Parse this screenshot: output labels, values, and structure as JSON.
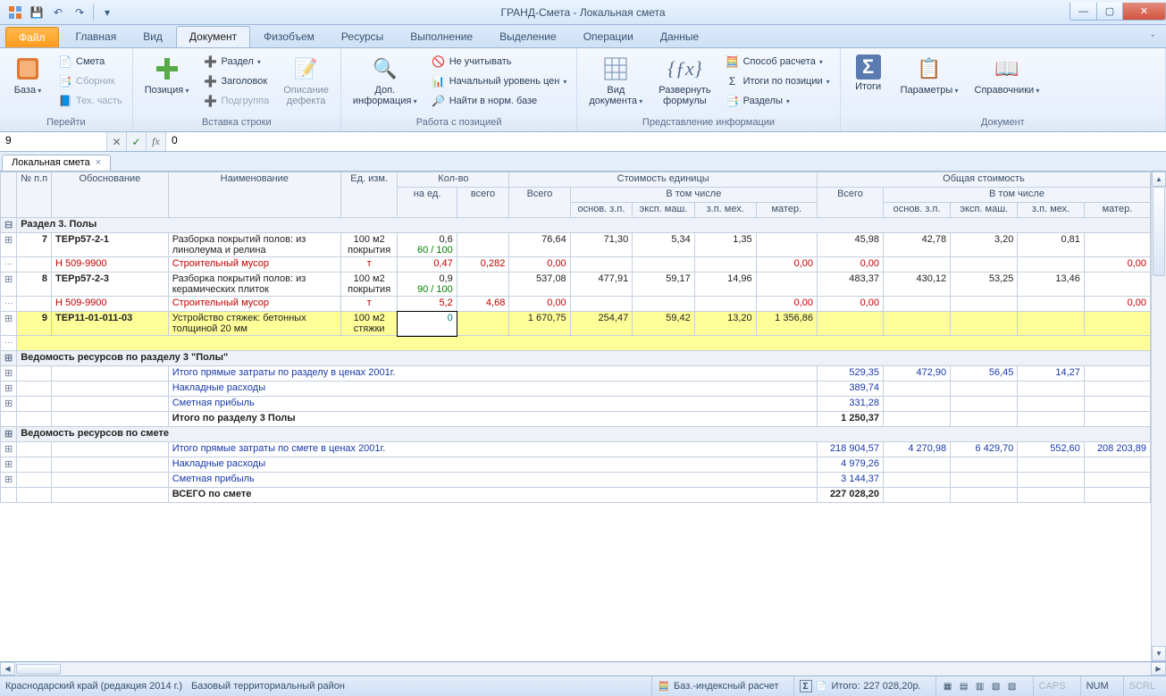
{
  "title": "ГРАНД-Смета - Локальная смета",
  "tabs": {
    "file": "Файл",
    "items": [
      "Главная",
      "Вид",
      "Документ",
      "Физобъем",
      "Ресурсы",
      "Выполнение",
      "Выделение",
      "Операции",
      "Данные"
    ],
    "active": 2
  },
  "ribbon": {
    "g1": {
      "label": "Перейти",
      "base": "База",
      "smeta": "Смета",
      "sbornik": "Сборник",
      "tech": "Тех. часть"
    },
    "g2": {
      "label": "Вставка строки",
      "pos": "Позиция",
      "razdel": "Раздел",
      "zagolovok": "Заголовок",
      "podgroup": "Подгруппа",
      "defect": "Описание\nдефекта"
    },
    "g3": {
      "label": "Работа с позицией",
      "dopinfo": "Доп.\nинформация",
      "neuchit": "Не учитывать",
      "nachur": "Начальный уровень цен",
      "najti": "Найти в норм. базе"
    },
    "g4": {
      "label": "Представление информации",
      "viddok": "Вид\nдокумента",
      "razvform": "Развернуть\nформулы",
      "sposob": "Способ расчета",
      "itogipos": "Итоги по позиции",
      "razdely": "Разделы"
    },
    "g5": {
      "label": "Документ",
      "itogi": "Итоги",
      "param": "Параметры",
      "sprav": "Справочники"
    }
  },
  "formula": {
    "cell": "9",
    "value": "0"
  },
  "doctab": "Локальная смета",
  "headers": {
    "num": "№\nп.п",
    "obj": "Обоснование",
    "name": "Наименование",
    "unit": "Ед. изм.",
    "qty": "Кол-во",
    "qty_ed": "на ед.",
    "qty_tot": "всего",
    "unitcost": "Стоимость единицы",
    "total": "Общая стоимость",
    "vsego": "Всего",
    "vtom": "В том числе",
    "oz": "основ. з.п.",
    "em": "эксп. маш.",
    "zm": "з.п. мех.",
    "mat": "матер."
  },
  "rows": {
    "section": "Раздел 3. Полы",
    "r7": {
      "n": "7",
      "obj": "ТЕРр57-2-1",
      "name": "Разборка покрытий полов: из линолеума и релина",
      "unit": "100 м2 покрытия",
      "qe": "0,6",
      "qf": "60 / 100",
      "uv": "76,64",
      "uo": "71,30",
      "ue": "5,34",
      "uz": "1,35",
      "tv": "45,98",
      "to": "42,78",
      "te": "3,20",
      "tz": "0,81"
    },
    "r7m": {
      "obj": "Н             509-9900",
      "name": "Строительный мусор",
      "unit": "т",
      "qe": "0,47",
      "qt": "0,282",
      "uv": "0,00",
      "um": "0,00",
      "tv": "0,00",
      "tm": "0,00"
    },
    "r8": {
      "n": "8",
      "obj": "ТЕРр57-2-3",
      "name": "Разборка покрытий полов: из керамических плиток",
      "unit": "100 м2 покрытия",
      "qe": "0,9",
      "qf": "90 / 100",
      "uv": "537,08",
      "uo": "477,91",
      "ue": "59,17",
      "uz": "14,96",
      "tv": "483,37",
      "to": "430,12",
      "te": "53,25",
      "tz": "13,46"
    },
    "r8m": {
      "obj": "Н             509-9900",
      "name": "Строительный мусор",
      "unit": "т",
      "qe": "5,2",
      "qt": "4,68",
      "uv": "0,00",
      "um": "0,00",
      "tv": "0,00",
      "tm": "0,00"
    },
    "r9": {
      "n": "9",
      "obj": "ТЕР11-01-011-03",
      "name": "Устройство стяжек: бетонных толщиной 20 мм",
      "unit": "100 м2 стяжки",
      "qe": "0",
      "uv": "1 670,75",
      "uo": "254,47",
      "ue": "59,42",
      "uz": "13,20",
      "um": "1 356,86"
    },
    "ved3": "Ведомость ресурсов по разделу 3 \"Полы\"",
    "itog3_1": {
      "name": "Итого прямые затраты по разделу в ценах 2001г.",
      "tv": "529,35",
      "to": "472,90",
      "te": "56,45",
      "tz": "14,27"
    },
    "itog3_2": {
      "name": "Накладные расходы",
      "tv": "389,74"
    },
    "itog3_3": {
      "name": "Сметная прибыль",
      "tv": "331,28"
    },
    "itog3_4": {
      "name": "Итого по разделу 3 Полы",
      "tv": "1 250,37"
    },
    "vedall": "Ведомость ресурсов по смете",
    "itall_1": {
      "name": "Итого прямые затраты по смете в ценах 2001г.",
      "tv": "218 904,57",
      "to": "4 270,98",
      "te": "6 429,70",
      "tz": "552,60",
      "tm": "208 203,89"
    },
    "itall_2": {
      "name": "Накладные расходы",
      "tv": "4 979,26"
    },
    "itall_3": {
      "name": "Сметная прибыль",
      "tv": "3 144,37"
    },
    "itall_4": {
      "name": "ВСЕГО по смете",
      "tv": "227 028,20"
    }
  },
  "status": {
    "region": "Краснодарский край (редакция 2014 г.)",
    "zone": "Базовый территориальный район",
    "calc": "Баз.-индексный расчет",
    "itogo_lbl": "Итого:",
    "itogo_val": "227 028,20р.",
    "caps": "CAPS",
    "num": "NUM",
    "scrl": "SCRL"
  }
}
